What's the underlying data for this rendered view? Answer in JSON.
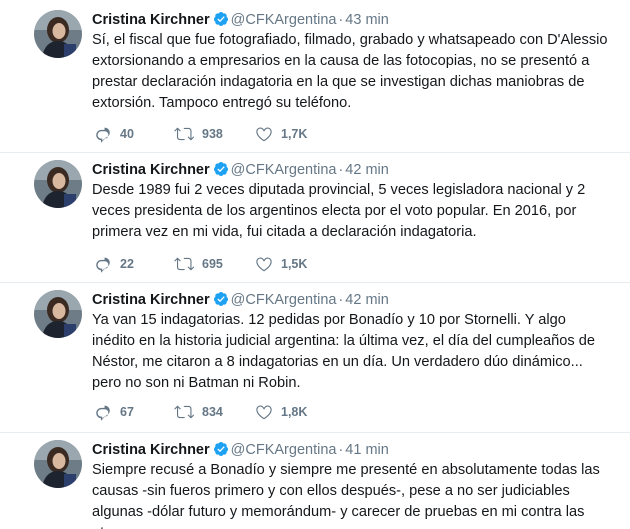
{
  "tweets": [
    {
      "name": "Cristina Kirchner",
      "handle": "@CFKArgentina",
      "separator": "·",
      "time": "43 min",
      "text": "Sí, el fiscal que fue fotografiado, filmado, grabado y whatsapeado con D'Alessio extorsionando a empresarios en la causa de las fotocopias, no se presentó a prestar declaración indagatoria en la que se investigan dichas maniobras de extorsión. Tampoco entregó su teléfono.",
      "replies": "40",
      "retweets": "938",
      "likes": "1,7K"
    },
    {
      "name": "Cristina Kirchner",
      "handle": "@CFKArgentina",
      "separator": "·",
      "time": "42 min",
      "text": "Desde 1989 fui 2 veces diputada provincial, 5 veces legisladora nacional y 2 veces presidenta de los argentinos electa por el voto popular. En 2016, por primera vez en mi vida, fui citada a declaración indagatoria.",
      "replies": "22",
      "retweets": "695",
      "likes": "1,5K"
    },
    {
      "name": "Cristina Kirchner",
      "handle": "@CFKArgentina",
      "separator": "·",
      "time": "42 min",
      "text": "Ya van 15 indagatorias. 12 pedidas por Bonadío y 10 por Stornelli. Y algo inédito en la historia judicial argentina: la última vez, el día del cumpleaños de Néstor, me citaron a 8 indagatorias en un día. Un verdadero dúo dinámico... pero no son ni Batman ni Robin.",
      "replies": "67",
      "retweets": "834",
      "likes": "1,8K"
    },
    {
      "name": "Cristina Kirchner",
      "handle": "@CFKArgentina",
      "separator": "·",
      "time": "41 min",
      "text": "Siempre recusé a Bonadío y siempre me presenté en absolutamente todas las causas -sin fueros primero y con ellos después-, pese a no ser judiciables algunas -dólar futuro y memorándum- y carecer de pruebas en mi contra las otras."
    }
  ],
  "icons": {
    "reply": "reply-icon",
    "retweet": "retweet-icon",
    "like": "heart-icon",
    "verified": "verified-badge-icon"
  },
  "colors": {
    "text": "#14171a",
    "secondary": "#657786",
    "verified": "#1da1f2",
    "divider": "#e6ecf0"
  }
}
